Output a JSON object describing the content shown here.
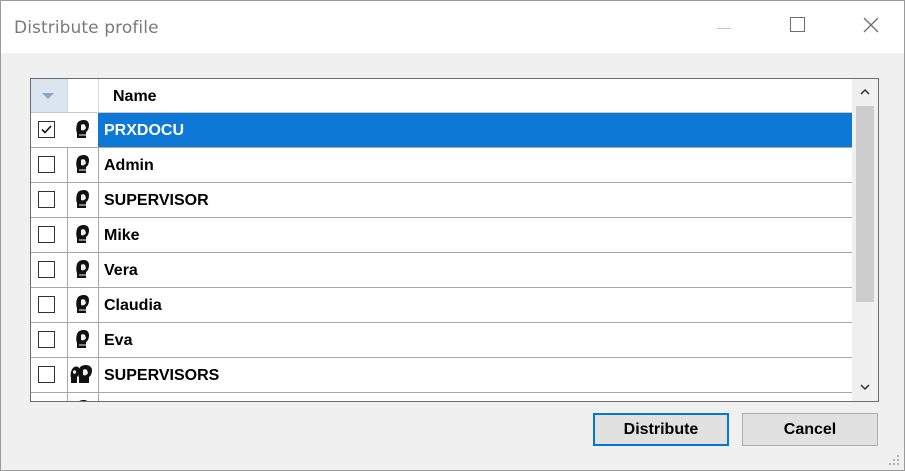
{
  "window": {
    "title": "Distribute profile"
  },
  "grid": {
    "columns": [
      "",
      "",
      "Name"
    ],
    "rows": [
      {
        "checked": true,
        "selected": true,
        "icon": "user-icon",
        "name": "PRXDOCU"
      },
      {
        "checked": false,
        "selected": false,
        "icon": "user-icon",
        "name": "Admin"
      },
      {
        "checked": false,
        "selected": false,
        "icon": "user-icon",
        "name": "SUPERVISOR"
      },
      {
        "checked": false,
        "selected": false,
        "icon": "user-icon",
        "name": "Mike"
      },
      {
        "checked": false,
        "selected": false,
        "icon": "user-icon",
        "name": "Vera"
      },
      {
        "checked": false,
        "selected": false,
        "icon": "user-icon",
        "name": "Claudia"
      },
      {
        "checked": false,
        "selected": false,
        "icon": "user-icon",
        "name": "Eva"
      },
      {
        "checked": false,
        "selected": false,
        "icon": "group-icon",
        "name": "SUPERVISORS"
      }
    ]
  },
  "buttons": {
    "distribute": "Distribute",
    "cancel": "Cancel"
  },
  "colors": {
    "selection": "#0e78d7",
    "focus_border": "#0078d7"
  }
}
